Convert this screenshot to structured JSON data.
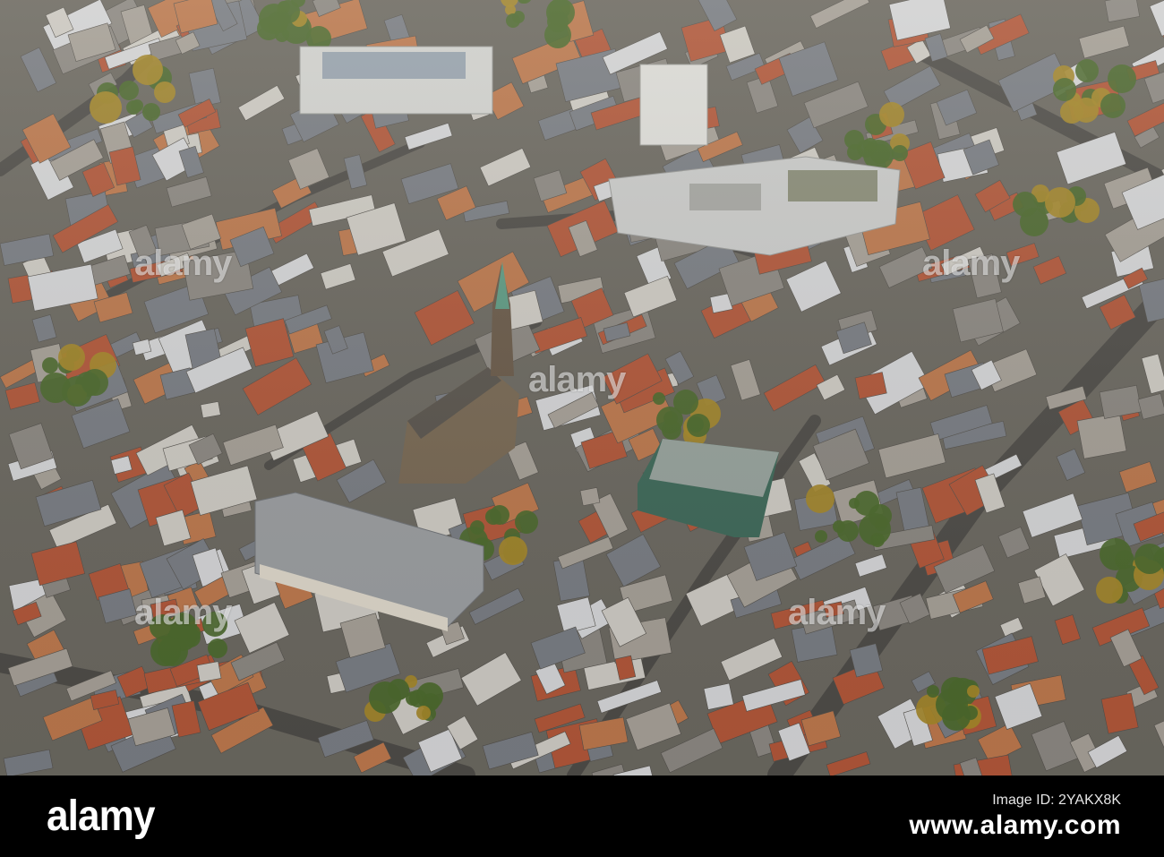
{
  "photo": {
    "subject": "aerial-city",
    "colors": {
      "roof_red": "#b5583a",
      "roof_grey": "#7b7f86",
      "roof_white": "#d9dadc",
      "tree_green": "#4d6b2e",
      "street": "#5e5c58",
      "church_spire": "#5f9e86",
      "glass_building": "#3f6b5b"
    }
  },
  "watermark": {
    "text": "alamy"
  },
  "footer": {
    "logo": "alamy",
    "id_label": "Image ID: 2YAKX8K",
    "id_prefix": "www.alamy.com",
    "background": "#000000",
    "text_color": "#ffffff"
  }
}
